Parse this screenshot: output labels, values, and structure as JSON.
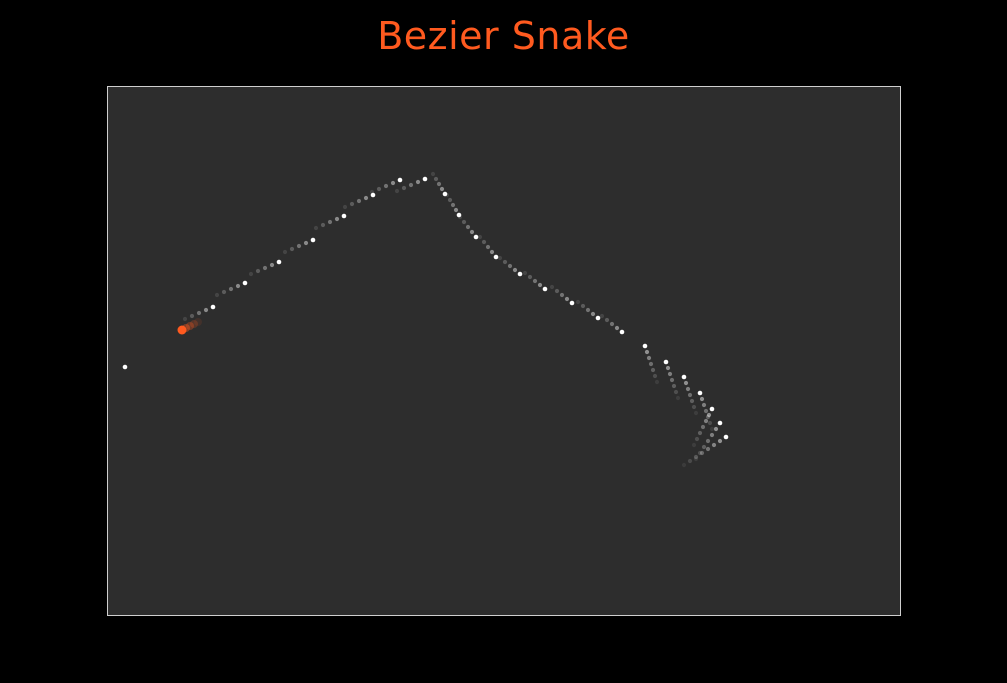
{
  "game": {
    "title": "Bezier Snake"
  },
  "colors": {
    "background": "#000000",
    "board": "#2d2d2d",
    "board_border": "#cfcfcf",
    "title": "#ff5a1f",
    "snake_head": "#ff5a1f",
    "snake_dot": "#ffffff"
  }
}
